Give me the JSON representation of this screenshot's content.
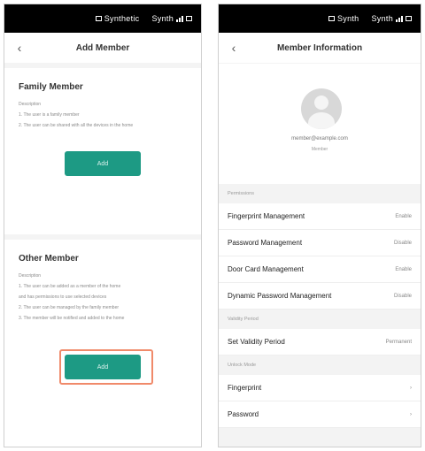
{
  "left": {
    "status": {
      "left_text": "Synthetic",
      "right_text": "Synth"
    },
    "nav_title": "Add Member",
    "back_glyph": "‹",
    "family": {
      "title": "Family Member",
      "desc": [
        "Description",
        "1. The user is a family member",
        "2. The user can be shared with all the devices in the home"
      ],
      "button": "Add"
    },
    "other": {
      "title": "Other Member",
      "desc": [
        "Description",
        "1. The user can be added as a member of the home",
        "and has permissions to use selected devices",
        "2. The user can be managed by the family member",
        "3. The member will be notified and added to the home"
      ],
      "button": "Add"
    }
  },
  "right": {
    "status": {
      "left_text": "Synth",
      "right_text": "Synth"
    },
    "nav_title": "Member Information",
    "back_glyph": "‹",
    "account": "member@example.com",
    "account_sub": "Member",
    "section_permissions": "Permissions",
    "rows1": [
      {
        "label": "Fingerprint Management",
        "value": "Enable"
      },
      {
        "label": "Password Management",
        "value": "Disable"
      },
      {
        "label": "Door Card Management",
        "value": "Enable"
      },
      {
        "label": "Dynamic Password Management",
        "value": "Disable"
      }
    ],
    "section_validity": "Validity Period",
    "rows2": [
      {
        "label": "Set Validity Period",
        "value": "Permanent"
      }
    ],
    "section_unlock": "Unlock Mode",
    "rows3": [
      {
        "label": "Fingerprint",
        "value": "›"
      },
      {
        "label": "Password",
        "value": "›"
      }
    ]
  }
}
